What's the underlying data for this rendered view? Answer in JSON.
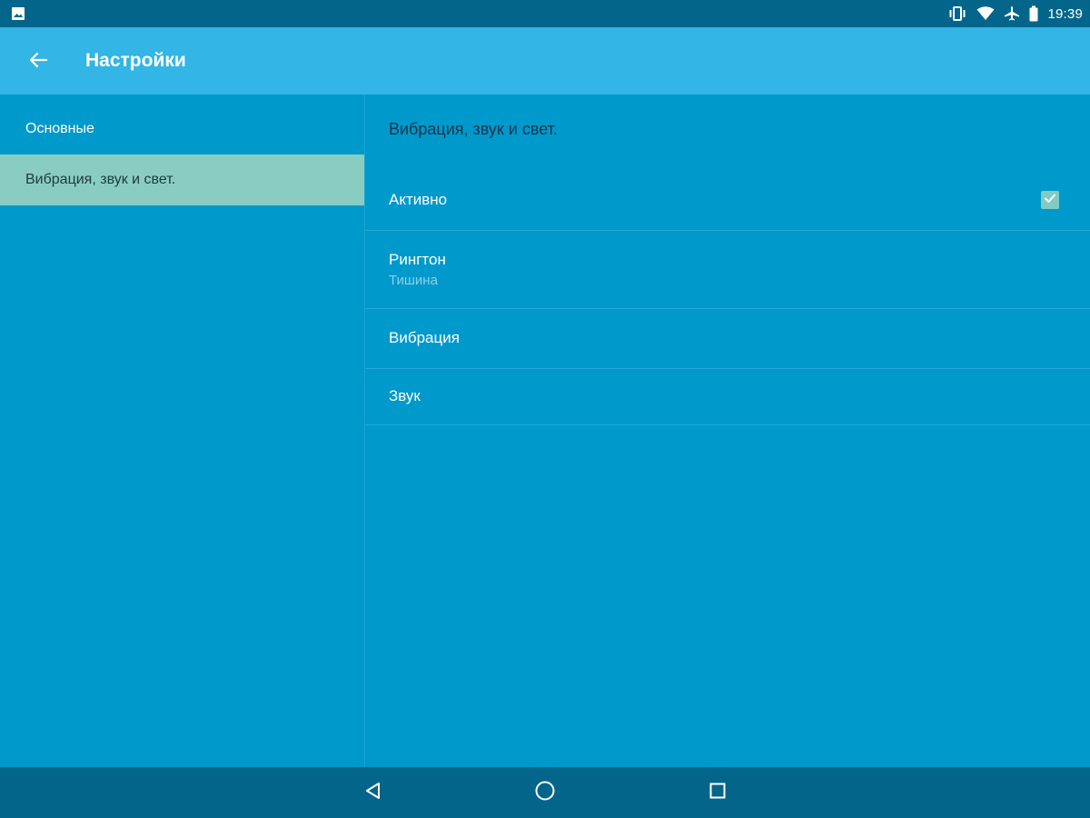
{
  "status_bar": {
    "time": "19:39",
    "icons": [
      "image-notification-icon",
      "vibrate-icon",
      "wifi-icon",
      "airplane-icon",
      "battery-icon"
    ]
  },
  "app_bar": {
    "title": "Настройки",
    "back_icon": "arrow-back-icon",
    "color": "#33b5e5"
  },
  "sidebar": {
    "items": [
      {
        "label": "Основные",
        "selected": false
      },
      {
        "label": "Вибрация, звук и свет.",
        "selected": true
      }
    ],
    "selected_color": "#89cdc2"
  },
  "detail": {
    "title": "Вибрация, звук и свет.",
    "prefs": [
      {
        "title": "Активно",
        "checked": true
      },
      {
        "title": "Рингтон",
        "summary": "Тишина"
      },
      {
        "title": "Вибрация"
      },
      {
        "title": "Звук"
      }
    ]
  },
  "nav_bar": {
    "buttons": [
      "back-triangle-icon",
      "home-circle-icon",
      "recents-square-icon"
    ]
  },
  "colors": {
    "background": "#0099cc",
    "status_bar": "#04658b",
    "checkbox": "#80cbc4"
  }
}
